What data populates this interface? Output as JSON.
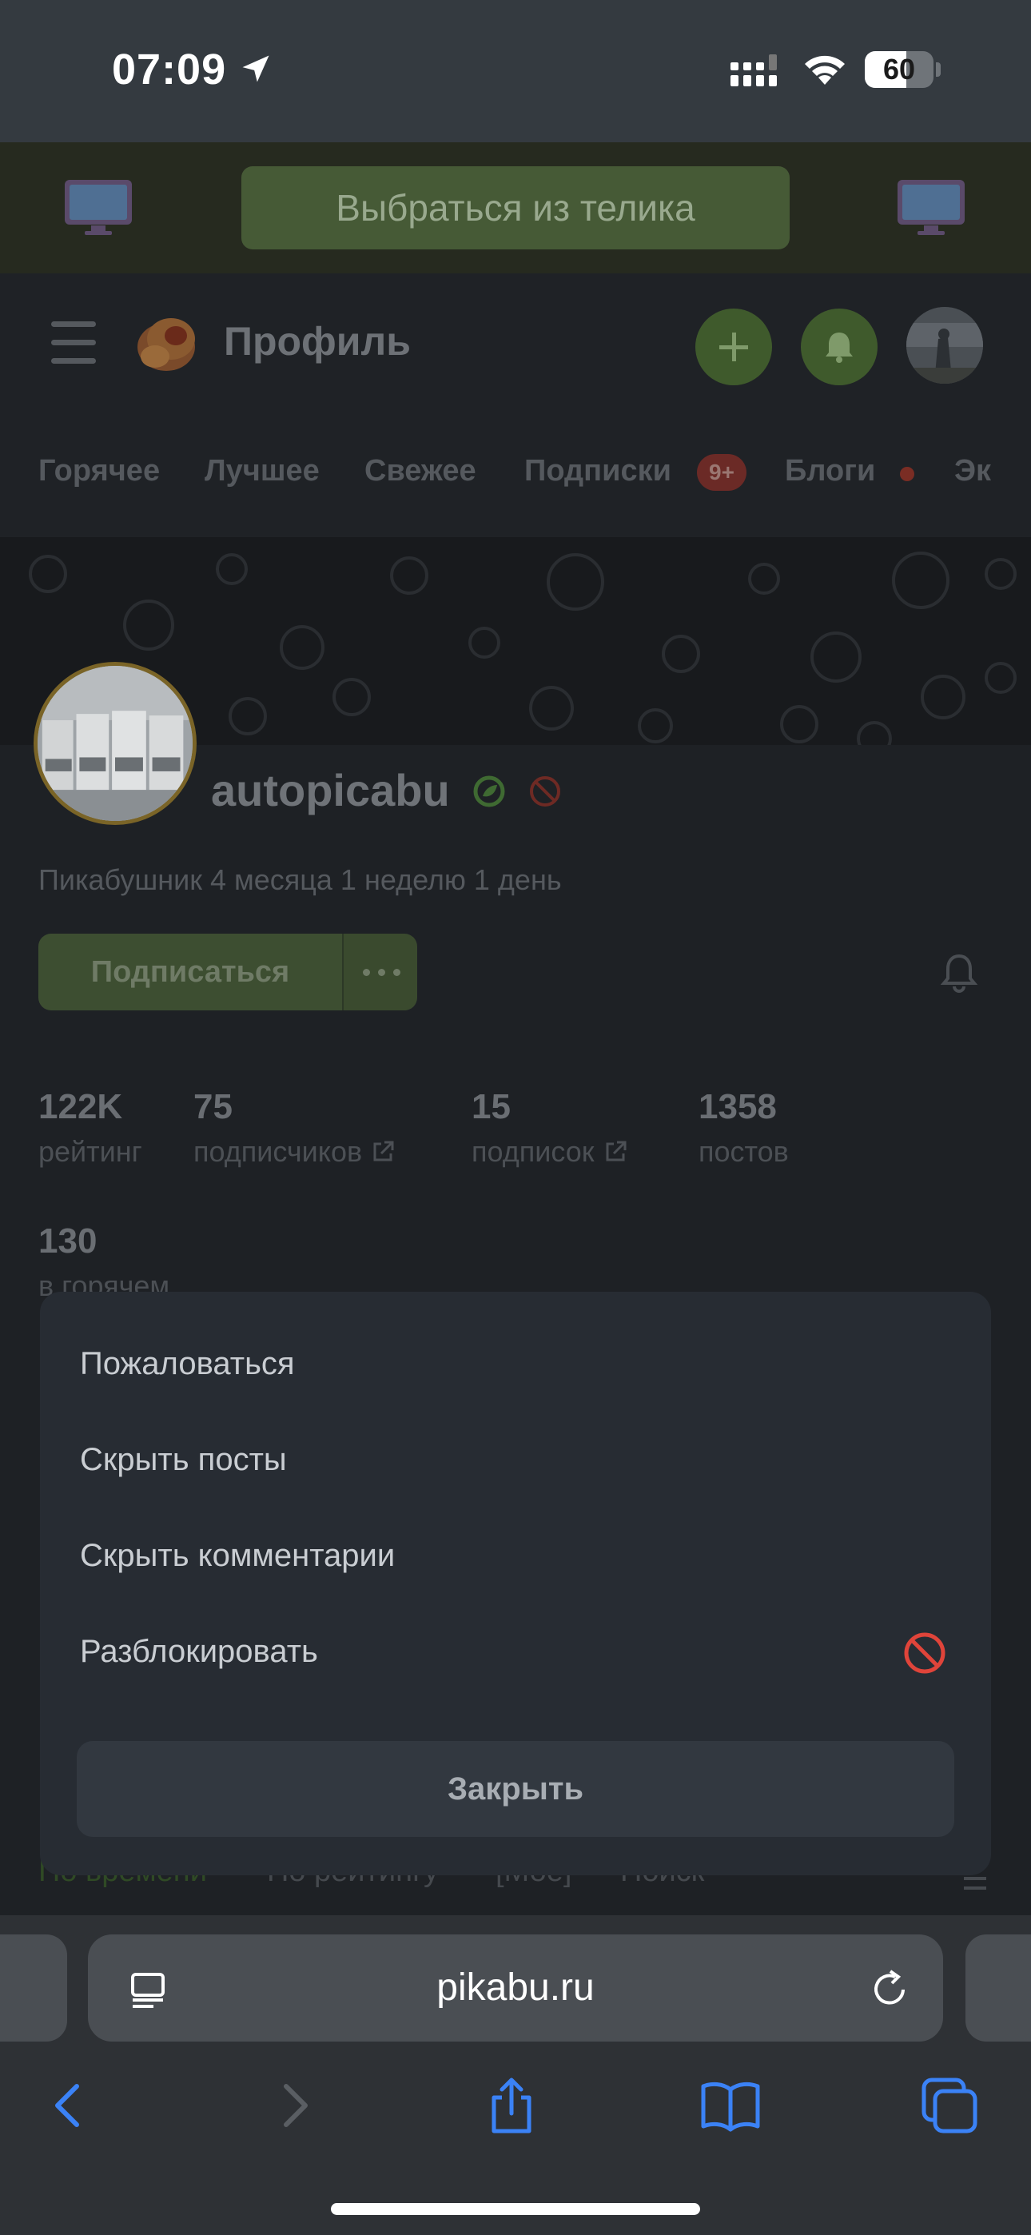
{
  "status_bar": {
    "time": "07:09",
    "battery": "60",
    "battery_level": 0.6,
    "icons": [
      "location-arrow-icon",
      "cellular-signal-icon",
      "wifi-icon",
      "battery-icon"
    ]
  },
  "banner": {
    "button_label": "Выбраться из телика",
    "icons": [
      "tv-icon",
      "tv-icon"
    ]
  },
  "header": {
    "title": "Профиль",
    "icons": [
      "hamburger-menu-icon",
      "pikabu-logo-icon",
      "plus-icon",
      "bell-icon",
      "avatar"
    ]
  },
  "nav": {
    "tabs": [
      "Горячее",
      "Лучшее",
      "Свежее",
      "Подписки",
      "Блоги",
      "Эк"
    ],
    "subscriptions_badge": "9+"
  },
  "profile": {
    "username": "autopicabu",
    "since": "Пикабушник 4 месяца 1 неделю 1 день",
    "subscribe_label": "Подписаться",
    "stats": [
      {
        "value": "122K",
        "label": "рейтинг"
      },
      {
        "value": "75",
        "label": "подписчиков"
      },
      {
        "value": "15",
        "label": "подписок"
      },
      {
        "value": "1358",
        "label": "постов"
      },
      {
        "value": "130",
        "label": "в горячем"
      }
    ]
  },
  "sheet": {
    "items": [
      "Пожаловаться",
      "Скрыть посты",
      "Скрыть комментарии",
      "Разблокировать"
    ],
    "close_label": "Закрыть",
    "unblock_icon_color": "#e0443a"
  },
  "sort_row": [
    "По времени",
    "По рейтингу",
    "[Мое]",
    "Поиск"
  ],
  "safari": {
    "url": "pikabu.ru",
    "toolbar_icons": [
      "back-icon",
      "forward-icon",
      "share-icon",
      "bookmarks-icon",
      "tabs-icon"
    ],
    "accent_color": "#3b82f6"
  }
}
